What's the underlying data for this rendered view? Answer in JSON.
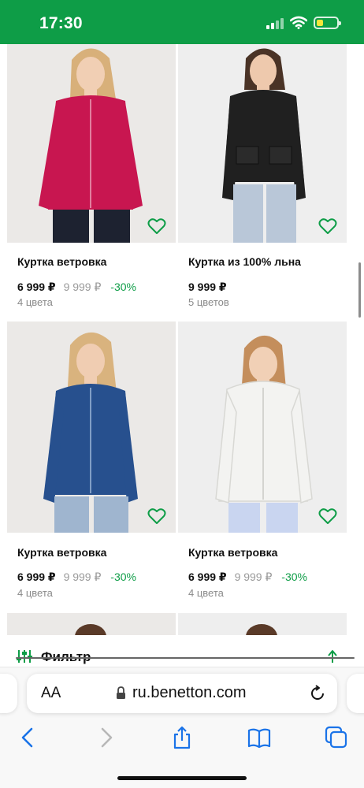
{
  "status_bar": {
    "time": "17:30"
  },
  "products": [
    {
      "name": "Куртка ветровка",
      "price": "6 999 ₽",
      "old_price": "9 999 ₽",
      "discount": "-30%",
      "colors": "4 цвета",
      "jacket_color": "#c81650",
      "favorite_icon": "heart-outline-icon"
    },
    {
      "name": "Куртка из 100% льна",
      "price": "9 999 ₽",
      "colors": "5 цветов",
      "jacket_color": "#202020",
      "favorite_icon": "heart-outline-icon"
    },
    {
      "name": "Куртка ветровка",
      "price": "6 999 ₽",
      "old_price": "9 999 ₽",
      "discount": "-30%",
      "colors": "4 цвета",
      "jacket_color": "#27508e",
      "favorite_icon": "heart-outline-icon"
    },
    {
      "name": "Куртка ветровка",
      "price": "6 999 ₽",
      "old_price": "9 999 ₽",
      "discount": "-30%",
      "colors": "4 цвета",
      "jacket_color": "#f3f3f1",
      "favorite_icon": "heart-outline-icon"
    }
  ],
  "filter_bar": {
    "label": "Фильтр",
    "icon": "sliders-icon",
    "scroll_top_icon": "arrow-up-icon"
  },
  "browser": {
    "reader_label": "AA",
    "url": "ru.benetton.com",
    "icons": [
      "back-icon",
      "forward-icon",
      "share-icon",
      "bookmarks-icon",
      "tabs-icon",
      "reload-icon",
      "lock-icon"
    ]
  },
  "colors": {
    "brand_green": "#0e9d47",
    "ios_blue": "#1a73e8",
    "muted_gray": "#9a9a9a"
  }
}
